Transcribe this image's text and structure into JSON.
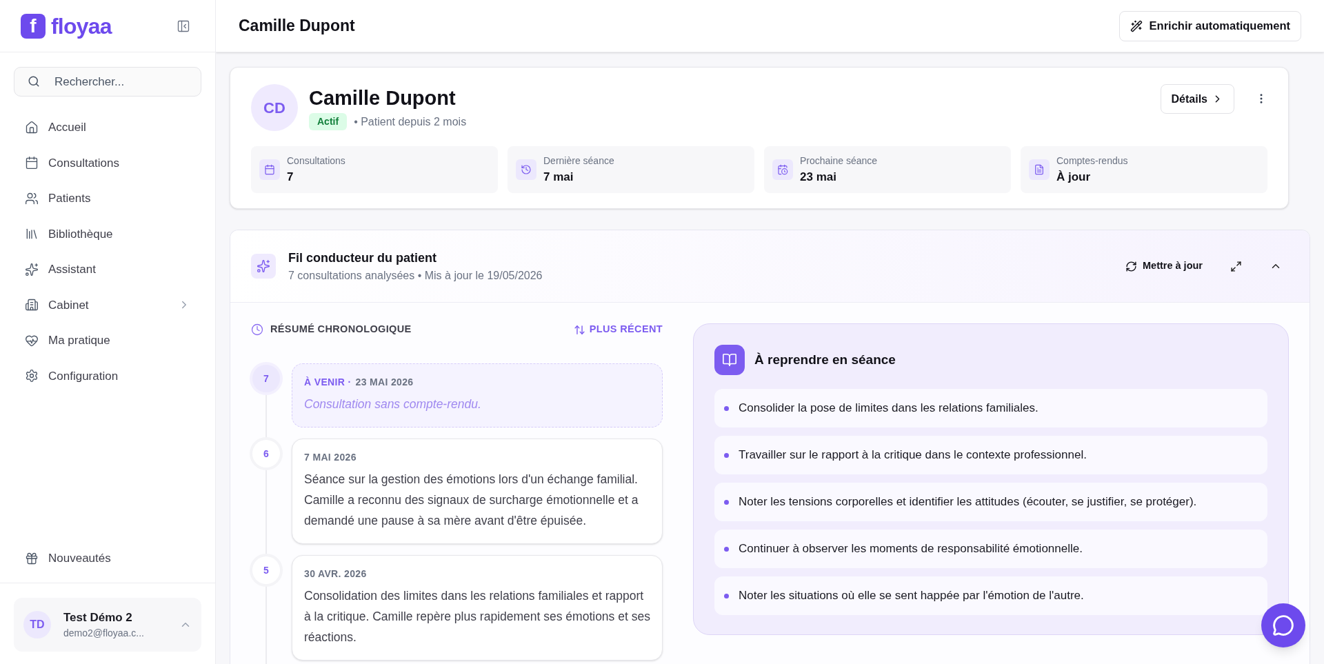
{
  "sidebar": {
    "logo": {
      "mark": "f",
      "name": "floyaa"
    },
    "search": {
      "placeholder": "Rechercher..."
    },
    "items": [
      {
        "label": "Accueil",
        "submenu": false
      },
      {
        "label": "Consultations",
        "submenu": false
      },
      {
        "label": "Patients",
        "submenu": false
      },
      {
        "label": "Bibliothèque",
        "submenu": false
      },
      {
        "label": "Assistant",
        "submenu": false
      },
      {
        "label": "Cabinet",
        "submenu": true
      },
      {
        "label": "Ma pratique",
        "submenu": false
      },
      {
        "label": "Configuration",
        "submenu": false
      }
    ],
    "bottom_item": {
      "label": "Nouveautés"
    },
    "user": {
      "initials": "TD",
      "name": "Test Démo 2",
      "email": "demo2@floyaa.c..."
    }
  },
  "header": {
    "title": "Camille Dupont",
    "action": "Enrichir automatiquement"
  },
  "profile": {
    "initials": "CD",
    "name": "Camille Dupont",
    "status": {
      "label": "Actif",
      "kind": "active"
    },
    "since": "• Patient depuis 2 mois",
    "details_button": "Détails",
    "stats": [
      {
        "label": "Consultations",
        "value": "7"
      },
      {
        "label": "Dernière séance",
        "value": "7 mai"
      },
      {
        "label": "Prochaine séance",
        "value": "23 mai"
      },
      {
        "label": "Comptes-rendus",
        "value": "À jour"
      }
    ]
  },
  "thread": {
    "title": "Fil conducteur du patient",
    "subtitle": "7 consultations analysées • Mis à jour le 19/05/2026",
    "update_button": "Mettre à jour",
    "section_title": "RÉSUMÉ CHRONOLOGIQUE",
    "sort_button": "PLUS RÉCENT",
    "timeline": [
      {
        "number": "7",
        "kind": "upcoming",
        "status": "À VENIR ·",
        "date": "23 MAI 2026",
        "text": "Consultation sans compte-rendu."
      },
      {
        "number": "6",
        "kind": "past",
        "date": "7 MAI 2026",
        "text": "Séance sur la gestion des émotions lors d'un échange familial. Camille a reconnu des signaux de surcharge émotionnelle et a demandé une pause à sa mère avant d'être épuisée."
      },
      {
        "number": "5",
        "kind": "past",
        "date": "30 AVR. 2026",
        "text": "Consolidation des limites dans les relations familiales et rapport à la critique. Camille repère plus rapidement ses émotions et ses réactions."
      }
    ],
    "panel": {
      "title": "À reprendre en séance",
      "items": [
        "Consolider la pose de limites dans les relations familiales.",
        "Travailler sur le rapport à la critique dans le contexte professionnel.",
        "Noter les tensions corporelles et identifier les attitudes (écouter, se justifier, se protéger).",
        "Continuer à observer les moments de responsabilité émotionnelle.",
        "Noter les situations où elle se sent happée par l'émotion de l'autre."
      ]
    }
  }
}
